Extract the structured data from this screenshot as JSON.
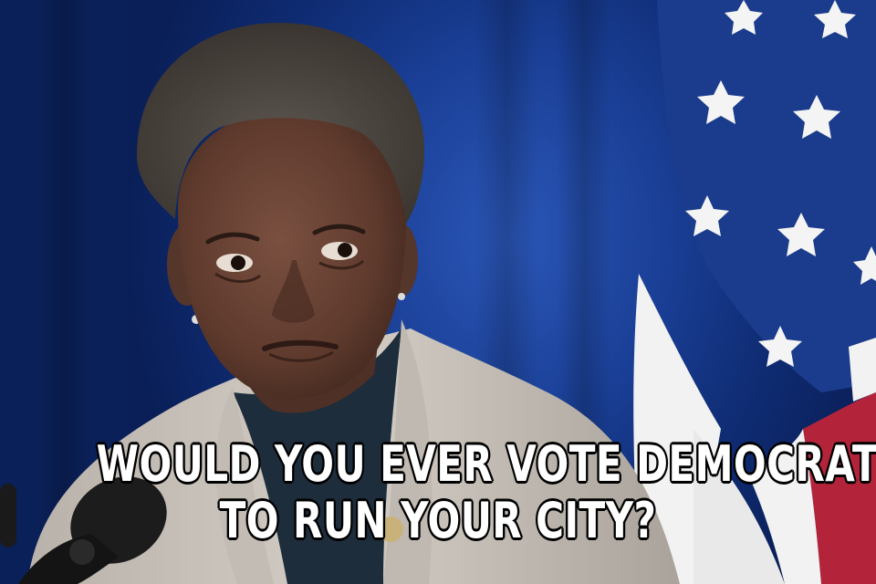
{
  "meme": {
    "caption_line1": "WOULD YOU EVER VOTE DEMOCRAT",
    "caption_line2": "TO RUN YOUR CITY?"
  },
  "colors": {
    "background_blue": "#1a3f96",
    "flag_red": "#b3243a",
    "flag_white": "#f2f2f2",
    "flag_blue": "#1b3c8c",
    "jacket": "#c9c3bb",
    "caption_text": "#ffffff",
    "caption_outline": "#000000"
  },
  "icons": [
    "flag-stars",
    "microphone"
  ]
}
